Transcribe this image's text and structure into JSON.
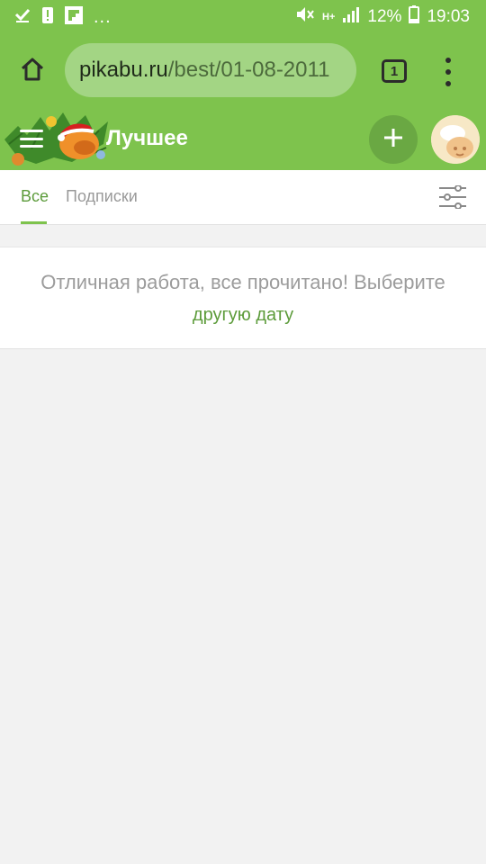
{
  "status_bar": {
    "time": "19:03",
    "battery": "12%",
    "network": "H+",
    "icons": [
      "download-done-icon",
      "alert-icon",
      "flipboard-icon",
      "more-dots-icon",
      "mute-icon",
      "network-icon",
      "signal-icon",
      "battery-icon"
    ],
    "dots": "..."
  },
  "browser": {
    "url_domain": "pikabu.ru",
    "url_path": "/best/01-08-2011",
    "tab_count": "1",
    "icons": [
      "home-icon",
      "tabs-icon",
      "more-vert-icon"
    ]
  },
  "header": {
    "title": "Лучшее",
    "icons": [
      "hamburger-icon",
      "add-icon",
      "avatar-icon"
    ]
  },
  "tabs": {
    "items": [
      {
        "label": "Все",
        "active": true
      },
      {
        "label": "Подписки",
        "active": false
      }
    ],
    "filter_icon": "filter-sliders-icon"
  },
  "message": {
    "text": "Отличная работа, все прочитано! Выберите",
    "link": "другую дату"
  },
  "colors": {
    "brand_green": "#7ec34d",
    "url_pill": "#a3d584",
    "accent_text": "#5c9b3a",
    "background": "#f2f2f2"
  }
}
